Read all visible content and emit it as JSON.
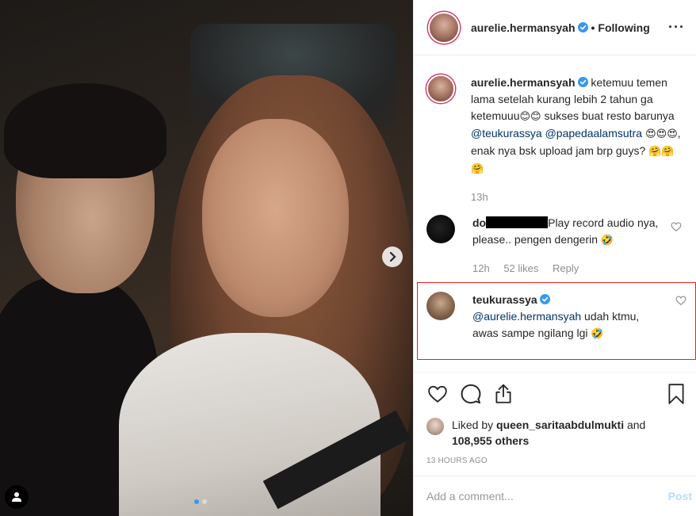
{
  "post": {
    "slide_count": 2,
    "active_slide": 1
  },
  "header": {
    "username": "aurelie.hermansyah",
    "separator": "•",
    "follow_status": "Following",
    "more_label": "···"
  },
  "caption": {
    "username": "aurelie.hermansyah",
    "text_1": " ketemuu temen lama setelah kurang lebih 2 tahun ga ketemuuu",
    "emoji_1": "😊😊",
    "text_2": " sukses buat resto barunya ",
    "mention_1": "@teukurassya",
    "mention_2": "@papedaalamsutra",
    "emoji_2": " 😍😍😍",
    "text_3": ", enak nya bsk upload jam brp guys? ",
    "emoji_3": "🤗🤗🤗",
    "time": "13h"
  },
  "comment_1": {
    "username_visible": "do",
    "text": "Play record audio nya, please.. pengen dengerin ",
    "emoji": "🤣",
    "time": "12h",
    "likes": "52 likes",
    "reply_label": "Reply"
  },
  "comment_2": {
    "username": "teukurassya",
    "mention": "@aurelie.hermansyah",
    "text": " udah ktmu, awas sampe ngilang lgi ",
    "emoji": "🤣"
  },
  "likes": {
    "prefix": "Liked by ",
    "user": "queen_saritaabdulmukti",
    "and": " and",
    "count": "108,955 others"
  },
  "timestamp": "13 HOURS AGO",
  "add_comment": {
    "placeholder": "Add a comment...",
    "post_label": "Post"
  },
  "colors": {
    "link": "#003569",
    "verified": "#3897f0",
    "highlight_border": "#ed1c24",
    "post_disabled": "#b2dffc"
  }
}
